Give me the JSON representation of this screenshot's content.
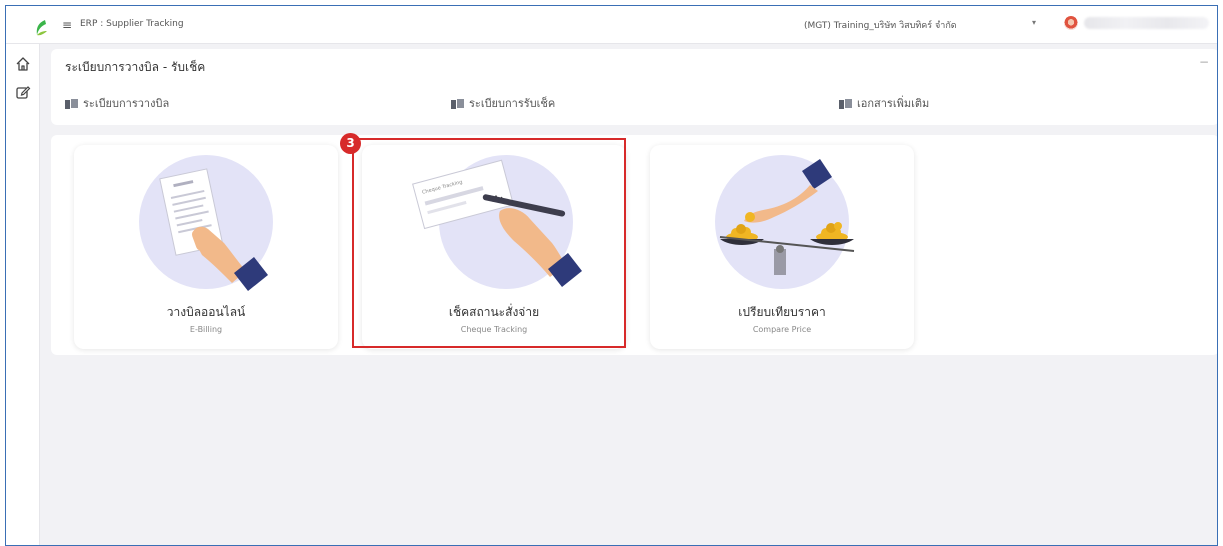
{
  "header": {
    "menu_icon": "hamburger-icon",
    "app_title": "ERP : Supplier Tracking",
    "company": "(MGT) Training_บริษัท วิสบทิคร์ จำกัด",
    "company_caret": "▾"
  },
  "sidebar": {
    "items": [
      {
        "icon": "home-icon"
      },
      {
        "icon": "edit-icon"
      }
    ]
  },
  "section": {
    "title": "ระเบียบการวางบิล - รับเช็ค",
    "collapse_label": "−",
    "links": [
      {
        "label": "ระเบียบการวางบิล",
        "icon": "documents-icon"
      },
      {
        "label": "ระเบียบการรับเช็ค",
        "icon": "documents-icon"
      },
      {
        "label": "เอกสารเพิ่มเติม",
        "icon": "documents-icon"
      }
    ]
  },
  "cards": [
    {
      "title": "วางบิลออนไลน์",
      "subtitle": "E-Billing",
      "icon": "invoice-hand-icon"
    },
    {
      "title": "เช็คสถานะสั่งจ่าย",
      "subtitle": "Cheque Tracking",
      "icon": "cheque-signing-icon",
      "cheque_text": "Cheque Tracking"
    },
    {
      "title": "เปรียบเทียบราคา",
      "subtitle": "Compare Price",
      "icon": "price-scale-icon"
    }
  ],
  "annotation": {
    "step": "3",
    "color": "#d72a2a"
  },
  "colors": {
    "accent_circle": "#e3e3f7",
    "hand_skin": "#f2b98a",
    "sleeve": "#2e3a7a",
    "coin": "#f0b623"
  }
}
